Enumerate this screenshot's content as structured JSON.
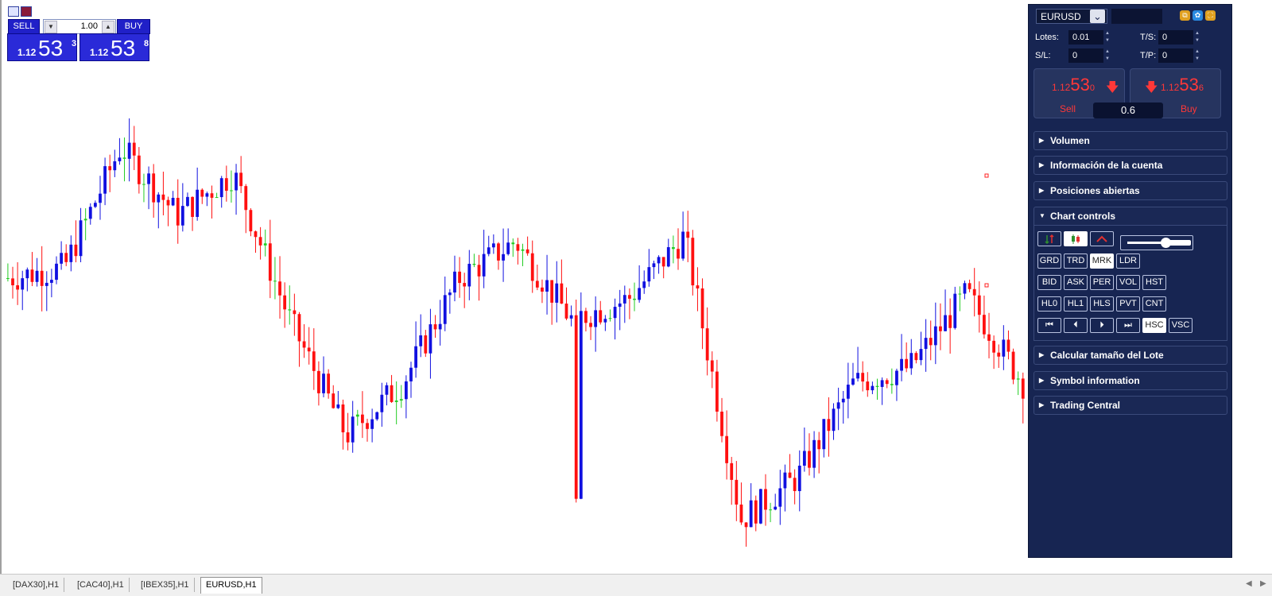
{
  "one_click": {
    "sell_label": "SELL",
    "buy_label": "BUY",
    "lot_value": "1.00",
    "spin_down": "▼",
    "spin_up": "▲",
    "sell_price": {
      "lead": "1.12",
      "big": "53",
      "sup": "3"
    },
    "buy_price": {
      "lead": "1.12",
      "big": "53",
      "sup": "8"
    }
  },
  "panel": {
    "symbol": "EURUSD",
    "symbol_arrow": "⌄",
    "fields": {
      "lots_label": "Lotes:",
      "lots_value": "0.01",
      "sl_label": "S/L:",
      "sl_value": "0",
      "ts_label": "T/S:",
      "ts_value": "0",
      "tp_label": "T/P:",
      "tp_value": "0"
    },
    "sell_tile": {
      "small": "1.12",
      "big": "53",
      "sub": "0",
      "label": "Sell"
    },
    "buy_tile": {
      "small": "1.12",
      "big": "53",
      "sub": "6",
      "label": "Buy"
    },
    "spread": "0.6",
    "sections_top": [
      {
        "label": "Volumen",
        "expanded": false
      },
      {
        "label": "Información de la cuenta",
        "expanded": false
      },
      {
        "label": "Posiciones abiertas",
        "expanded": false
      }
    ],
    "chart_controls_label": "Chart controls",
    "chart_controls": {
      "slider_level": 0.68,
      "rows": [
        [
          {
            "label": "GRD",
            "on": false
          },
          {
            "label": "TRD",
            "on": false
          },
          {
            "label": "MRK",
            "on": true
          },
          {
            "label": "LDR",
            "on": false
          }
        ],
        [
          {
            "label": "BID",
            "on": false
          },
          {
            "label": "ASK",
            "on": false
          },
          {
            "label": "PER",
            "on": false
          },
          {
            "label": "VOL",
            "on": false
          },
          {
            "label": "HST",
            "on": false
          }
        ],
        [
          {
            "label": "HL0",
            "on": false
          },
          {
            "label": "HL1",
            "on": false
          },
          {
            "label": "HLS",
            "on": false
          },
          {
            "label": "PVT",
            "on": false
          },
          {
            "label": "CNT",
            "on": false
          }
        ],
        [
          {
            "label": "⏮",
            "on": false
          },
          {
            "label": "⏴",
            "on": false
          },
          {
            "label": "⏵",
            "on": false
          },
          {
            "label": "⏭",
            "on": false
          },
          {
            "label": "HSC",
            "on": true
          },
          {
            "label": "VSC",
            "on": false
          }
        ]
      ]
    },
    "sections_bottom": [
      {
        "label": "Calcular tamaño del Lote"
      },
      {
        "label": "Symbol information"
      },
      {
        "label": "Trading Central"
      }
    ]
  },
  "tabs": [
    {
      "label": "[DAX30],H1",
      "active": false
    },
    {
      "label": "[CAC40],H1",
      "active": false
    },
    {
      "label": "[IBEX35],H1",
      "active": false
    },
    {
      "label": "EURUSD,H1",
      "active": true
    }
  ],
  "colors": {
    "bull": "#1010e0",
    "bear": "#ff1010",
    "neutral": "#22cc22",
    "panel_bg": "#172552"
  },
  "chart_data": {
    "type": "candlestick",
    "symbol": "EURUSD",
    "timeframe": "H1",
    "ohlc_shape": [
      [
        0.5,
        0.45,
        0.58,
        0.6
      ],
      [
        0.52,
        0.28,
        0.7,
        0.65
      ],
      [
        0.75,
        0.72,
        0.48,
        0.58
      ],
      [
        0.62,
        0.26,
        0.65,
        0.7
      ],
      [
        0.7,
        0.6,
        0.48,
        0.4
      ],
      [
        0.42,
        0.4,
        0.2,
        0.18
      ],
      [
        0.2,
        0.15,
        0.25,
        0.27
      ],
      [
        0.3,
        0.28,
        0.48,
        0.5
      ],
      [
        0.5,
        0.46,
        0.55,
        0.56
      ],
      [
        0.57,
        0.55,
        0.45,
        0.43
      ],
      [
        0.42,
        0.41,
        0.44,
        0.46
      ],
      [
        0.46,
        0.44,
        0.4,
        0.4
      ],
      [
        0.58,
        0.58,
        0.25,
        0.05
      ],
      [
        0.04,
        0.03,
        0.06,
        0.1
      ],
      [
        0.12,
        0.15,
        0.3,
        0.31
      ],
      [
        0.3,
        0.29,
        0.32,
        0.34
      ],
      [
        0.33,
        0.3,
        0.44,
        0.48
      ],
      [
        0.47,
        0.46,
        0.36,
        0.33
      ],
      [
        0.3,
        0.25,
        0.4,
        0.41
      ]
    ]
  }
}
